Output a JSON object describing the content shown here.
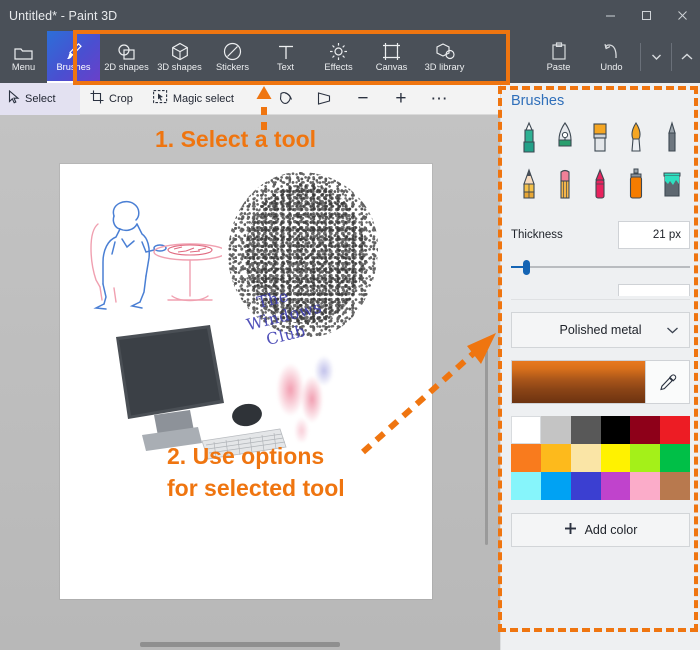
{
  "window": {
    "title": "Untitled* - Paint 3D",
    "controls": [
      {
        "name": "minimize-button",
        "glyph": "minimize"
      },
      {
        "name": "maximize-button",
        "glyph": "maximize"
      },
      {
        "name": "close-button",
        "glyph": "close"
      }
    ]
  },
  "ribbon": {
    "menu": {
      "label": "Menu",
      "icon": "folder-icon"
    },
    "tools": [
      {
        "label": "Brushes",
        "icon": "brush-icon",
        "active": true
      },
      {
        "label": "2D shapes",
        "icon": "2d-shapes-icon",
        "active": false
      },
      {
        "label": "3D shapes",
        "icon": "3d-shapes-icon",
        "active": false
      },
      {
        "label": "Stickers",
        "icon": "stickers-icon",
        "active": false
      },
      {
        "label": "Text",
        "icon": "text-icon",
        "active": false
      },
      {
        "label": "Effects",
        "icon": "effects-icon",
        "active": false
      },
      {
        "label": "Canvas",
        "icon": "canvas-icon",
        "active": false
      },
      {
        "label": "3D library",
        "icon": "3d-library-icon",
        "active": false
      }
    ],
    "right": [
      {
        "label": "Paste",
        "icon": "paste-icon"
      },
      {
        "label": "Undo",
        "icon": "undo-icon"
      }
    ],
    "dropdown_icon": "chevron-down-icon",
    "collapse_icon": "chevron-up-icon"
  },
  "subtoolbar": {
    "select": {
      "label": "Select",
      "icon": "cursor-arrow-icon"
    },
    "crop": {
      "label": "Crop",
      "icon": "crop-icon"
    },
    "magic_select": {
      "label": "Magic select",
      "icon": "magic-select-icon"
    },
    "icons": [
      {
        "name": "3d-view-icon"
      },
      {
        "name": "perspective-icon"
      },
      {
        "name": "zoom-out-icon",
        "glyph": "−"
      },
      {
        "name": "zoom-in-icon",
        "glyph": "+"
      },
      {
        "name": "more-options-icon",
        "glyph": "⋯"
      }
    ]
  },
  "panel": {
    "title": "Brushes",
    "brushes": [
      {
        "name": "marker",
        "row": 1
      },
      {
        "name": "calligraphy-pen",
        "row": 1
      },
      {
        "name": "oil-brush",
        "row": 1
      },
      {
        "name": "watercolor",
        "row": 1
      },
      {
        "name": "pixel-pen",
        "row": 1
      },
      {
        "name": "pencil",
        "row": 2
      },
      {
        "name": "eraser",
        "row": 2
      },
      {
        "name": "crayon",
        "row": 2
      },
      {
        "name": "spray-can",
        "row": 2
      },
      {
        "name": "fill",
        "row": 2
      }
    ],
    "thickness": {
      "label": "Thickness",
      "value": "21 px",
      "slider_percent": 7
    },
    "material": {
      "value": "Polished metal",
      "chevron": "chevron-down-icon"
    },
    "current_color": "#c2641a",
    "eyedropper_icon": "eyedropper-icon",
    "swatches": [
      "#ffffff",
      "#c4c4c4",
      "#585858",
      "#000000",
      "#8e0019",
      "#ed1c24",
      "#f97b1d",
      "#fdba1c",
      "#fae5a6",
      "#fff200",
      "#a4f019",
      "#00bf47",
      "#86f5fb",
      "#00a2f3",
      "#3b3fd1",
      "#c043cc",
      "#fbacc9",
      "#b8794e"
    ],
    "add_color": {
      "label": "Add color",
      "icon": "plus-icon"
    }
  },
  "canvas": {
    "handwriting": [
      "The",
      "Windows",
      "Club"
    ]
  },
  "annotations": {
    "step1": "1. Select a tool",
    "step2_line1": "2. Use options",
    "step2_line2": "for selected tool",
    "accent_color": "#ef7510"
  }
}
